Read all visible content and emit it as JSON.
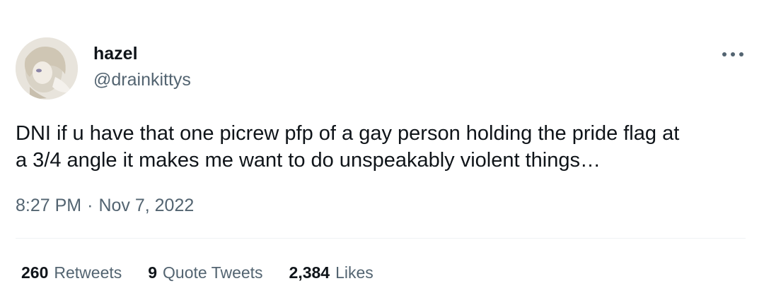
{
  "author": {
    "display_name": "hazel",
    "handle": "@drainkittys",
    "avatar_icon": "avatar-illustration"
  },
  "tweet": {
    "text": "DNI if u have that one picrew pfp of a gay person holding the pride flag at\na 3/4 angle it makes me want to do unspeakably violent things…"
  },
  "meta": {
    "time": "8:27 PM",
    "separator": "·",
    "date": "Nov 7, 2022"
  },
  "stats": {
    "retweets": {
      "count": "260",
      "label": "Retweets"
    },
    "quote_tweets": {
      "count": "9",
      "label": "Quote Tweets"
    },
    "likes": {
      "count": "2,384",
      "label": "Likes"
    }
  },
  "icons": {
    "more": "more-horizontal-icon"
  },
  "colors": {
    "primary_text": "#0f1419",
    "secondary_text": "#536471",
    "divider": "#eff3f4"
  }
}
